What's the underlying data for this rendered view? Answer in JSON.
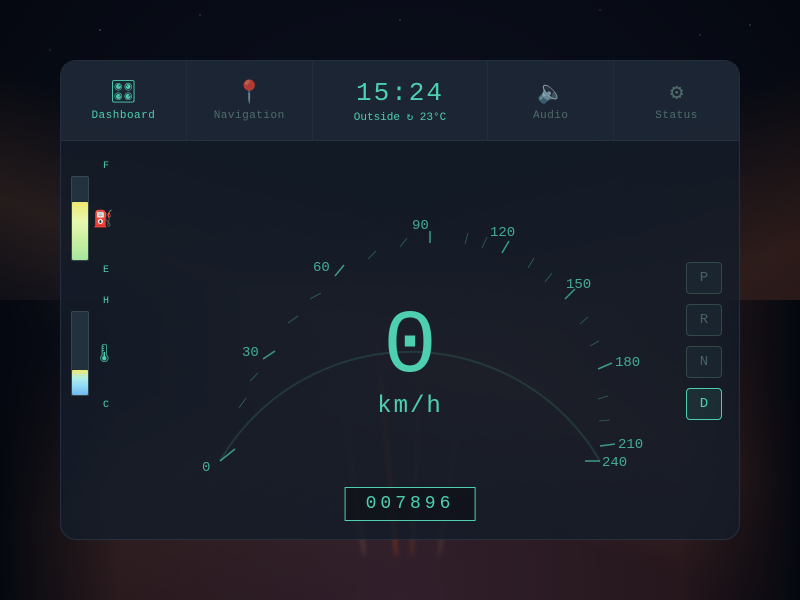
{
  "background": {
    "color": "#0a0e1a"
  },
  "nav": {
    "items": [
      {
        "id": "dashboard",
        "label": "Dashboard",
        "icon": "🎛",
        "active": true
      },
      {
        "id": "navigation",
        "label": "Navigation",
        "icon": "📍",
        "active": false
      },
      {
        "id": "time",
        "label": "",
        "icon": "",
        "active": false,
        "is_center": true
      },
      {
        "id": "audio",
        "label": "Audio",
        "icon": "🔈",
        "active": false
      },
      {
        "id": "status",
        "label": "Status",
        "icon": "⚙",
        "active": false
      }
    ],
    "time": "15:24",
    "weather_icon": "↻",
    "temperature": "Outside ↻ 23°C"
  },
  "speedometer": {
    "current_speed": "0",
    "unit": "km/h",
    "min": 0,
    "max": 240,
    "tick_labels": [
      "0",
      "30",
      "60",
      "90",
      "120",
      "150",
      "180",
      "210",
      "240"
    ]
  },
  "odometer": {
    "value": "007896"
  },
  "fuel_gauge": {
    "top_label": "F",
    "bottom_label": "E",
    "level_percent": 70,
    "icon": "⛽"
  },
  "temp_gauge": {
    "top_label": "H",
    "bottom_label": "C",
    "level_percent": 30,
    "icon": "🌡"
  },
  "gears": [
    {
      "label": "P",
      "active": false
    },
    {
      "label": "R",
      "active": false
    },
    {
      "label": "N",
      "active": false
    },
    {
      "label": "D",
      "active": true
    }
  ],
  "colors": {
    "accent": "#4ecfb0",
    "bg_card": "rgba(20,28,40,0.85)",
    "nav_bg": "rgba(30,38,52,0.95)"
  }
}
